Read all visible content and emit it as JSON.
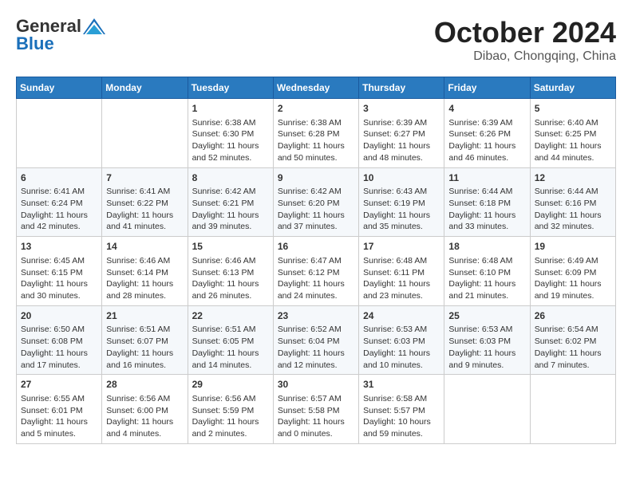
{
  "logo": {
    "general": "General",
    "blue": "Blue"
  },
  "title": "October 2024",
  "location": "Dibao, Chongqing, China",
  "days_of_week": [
    "Sunday",
    "Monday",
    "Tuesday",
    "Wednesday",
    "Thursday",
    "Friday",
    "Saturday"
  ],
  "weeks": [
    [
      {
        "day": "",
        "content": ""
      },
      {
        "day": "",
        "content": ""
      },
      {
        "day": "1",
        "content": "Sunrise: 6:38 AM\nSunset: 6:30 PM\nDaylight: 11 hours and 52 minutes."
      },
      {
        "day": "2",
        "content": "Sunrise: 6:38 AM\nSunset: 6:28 PM\nDaylight: 11 hours and 50 minutes."
      },
      {
        "day": "3",
        "content": "Sunrise: 6:39 AM\nSunset: 6:27 PM\nDaylight: 11 hours and 48 minutes."
      },
      {
        "day": "4",
        "content": "Sunrise: 6:39 AM\nSunset: 6:26 PM\nDaylight: 11 hours and 46 minutes."
      },
      {
        "day": "5",
        "content": "Sunrise: 6:40 AM\nSunset: 6:25 PM\nDaylight: 11 hours and 44 minutes."
      }
    ],
    [
      {
        "day": "6",
        "content": "Sunrise: 6:41 AM\nSunset: 6:24 PM\nDaylight: 11 hours and 42 minutes."
      },
      {
        "day": "7",
        "content": "Sunrise: 6:41 AM\nSunset: 6:22 PM\nDaylight: 11 hours and 41 minutes."
      },
      {
        "day": "8",
        "content": "Sunrise: 6:42 AM\nSunset: 6:21 PM\nDaylight: 11 hours and 39 minutes."
      },
      {
        "day": "9",
        "content": "Sunrise: 6:42 AM\nSunset: 6:20 PM\nDaylight: 11 hours and 37 minutes."
      },
      {
        "day": "10",
        "content": "Sunrise: 6:43 AM\nSunset: 6:19 PM\nDaylight: 11 hours and 35 minutes."
      },
      {
        "day": "11",
        "content": "Sunrise: 6:44 AM\nSunset: 6:18 PM\nDaylight: 11 hours and 33 minutes."
      },
      {
        "day": "12",
        "content": "Sunrise: 6:44 AM\nSunset: 6:16 PM\nDaylight: 11 hours and 32 minutes."
      }
    ],
    [
      {
        "day": "13",
        "content": "Sunrise: 6:45 AM\nSunset: 6:15 PM\nDaylight: 11 hours and 30 minutes."
      },
      {
        "day": "14",
        "content": "Sunrise: 6:46 AM\nSunset: 6:14 PM\nDaylight: 11 hours and 28 minutes."
      },
      {
        "day": "15",
        "content": "Sunrise: 6:46 AM\nSunset: 6:13 PM\nDaylight: 11 hours and 26 minutes."
      },
      {
        "day": "16",
        "content": "Sunrise: 6:47 AM\nSunset: 6:12 PM\nDaylight: 11 hours and 24 minutes."
      },
      {
        "day": "17",
        "content": "Sunrise: 6:48 AM\nSunset: 6:11 PM\nDaylight: 11 hours and 23 minutes."
      },
      {
        "day": "18",
        "content": "Sunrise: 6:48 AM\nSunset: 6:10 PM\nDaylight: 11 hours and 21 minutes."
      },
      {
        "day": "19",
        "content": "Sunrise: 6:49 AM\nSunset: 6:09 PM\nDaylight: 11 hours and 19 minutes."
      }
    ],
    [
      {
        "day": "20",
        "content": "Sunrise: 6:50 AM\nSunset: 6:08 PM\nDaylight: 11 hours and 17 minutes."
      },
      {
        "day": "21",
        "content": "Sunrise: 6:51 AM\nSunset: 6:07 PM\nDaylight: 11 hours and 16 minutes."
      },
      {
        "day": "22",
        "content": "Sunrise: 6:51 AM\nSunset: 6:05 PM\nDaylight: 11 hours and 14 minutes."
      },
      {
        "day": "23",
        "content": "Sunrise: 6:52 AM\nSunset: 6:04 PM\nDaylight: 11 hours and 12 minutes."
      },
      {
        "day": "24",
        "content": "Sunrise: 6:53 AM\nSunset: 6:03 PM\nDaylight: 11 hours and 10 minutes."
      },
      {
        "day": "25",
        "content": "Sunrise: 6:53 AM\nSunset: 6:03 PM\nDaylight: 11 hours and 9 minutes."
      },
      {
        "day": "26",
        "content": "Sunrise: 6:54 AM\nSunset: 6:02 PM\nDaylight: 11 hours and 7 minutes."
      }
    ],
    [
      {
        "day": "27",
        "content": "Sunrise: 6:55 AM\nSunset: 6:01 PM\nDaylight: 11 hours and 5 minutes."
      },
      {
        "day": "28",
        "content": "Sunrise: 6:56 AM\nSunset: 6:00 PM\nDaylight: 11 hours and 4 minutes."
      },
      {
        "day": "29",
        "content": "Sunrise: 6:56 AM\nSunset: 5:59 PM\nDaylight: 11 hours and 2 minutes."
      },
      {
        "day": "30",
        "content": "Sunrise: 6:57 AM\nSunset: 5:58 PM\nDaylight: 11 hours and 0 minutes."
      },
      {
        "day": "31",
        "content": "Sunrise: 6:58 AM\nSunset: 5:57 PM\nDaylight: 10 hours and 59 minutes."
      },
      {
        "day": "",
        "content": ""
      },
      {
        "day": "",
        "content": ""
      }
    ]
  ]
}
